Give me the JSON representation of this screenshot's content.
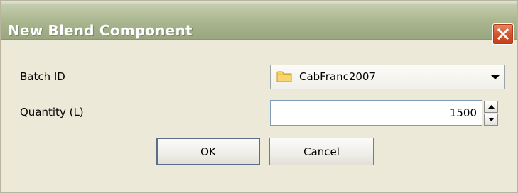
{
  "window": {
    "title": "New Blend Component",
    "close_icon": "close-x-icon"
  },
  "form": {
    "batch_label": "Batch ID",
    "batch_value": "CabFranc2007",
    "batch_icon": "folder-icon",
    "quantity_label": "Quantity (L)",
    "quantity_value": "1500"
  },
  "buttons": {
    "ok_label": "OK",
    "cancel_label": "Cancel"
  },
  "colors": {
    "titlebar": "#a7b38c",
    "dialog_bg": "#ece9d8",
    "close_button": "#d4572f",
    "folder": "#f5c64a"
  }
}
